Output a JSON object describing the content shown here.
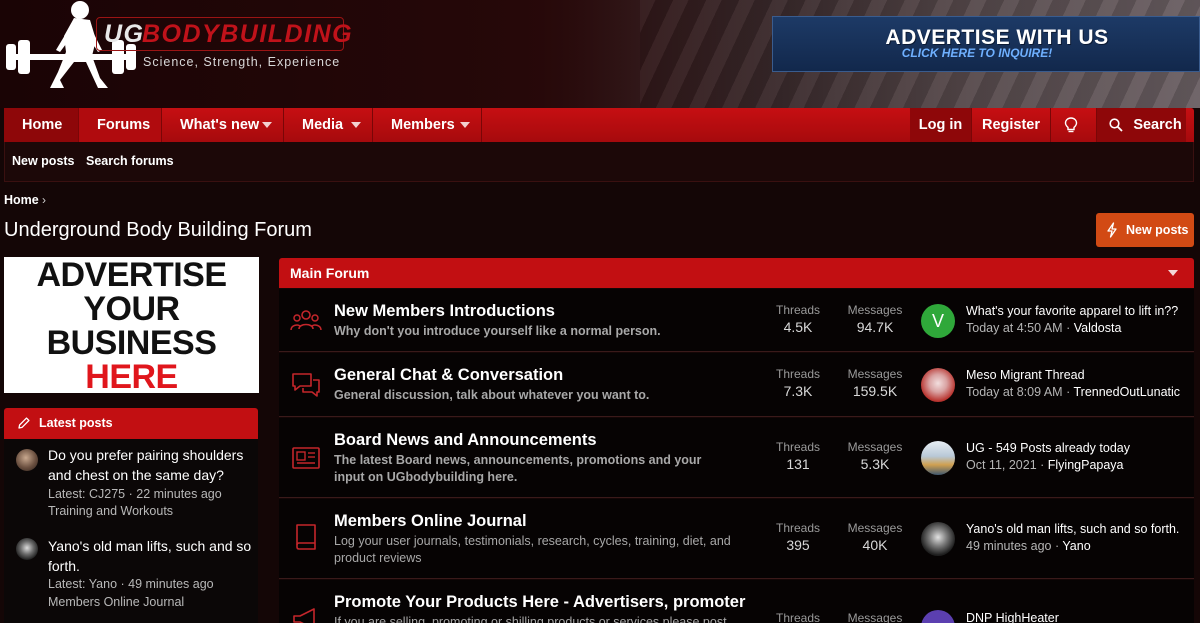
{
  "header": {
    "logo_ug": "UG",
    "logo_bb": "BODYBUILDING",
    "logo_tagline": "Science, Strength, Experience",
    "ad_title": "ADVERTISE WITH US",
    "ad_subtitle": "CLICK HERE TO INQUIRE!"
  },
  "nav": {
    "home": "Home",
    "forums": "Forums",
    "whats_new": "What's new",
    "media": "Media",
    "members": "Members",
    "login": "Log in",
    "register": "Register",
    "search": "Search"
  },
  "subnav": {
    "new_posts": "New posts",
    "search_forums": "Search forums"
  },
  "breadcrumb": {
    "home": "Home",
    "sep": "›"
  },
  "page": {
    "title": "Underground Body Building Forum",
    "new_posts_button": "New posts"
  },
  "sidebar": {
    "ad_lines": [
      "ADVERTISE",
      "YOUR",
      "BUSINESS",
      "HERE"
    ],
    "latest_title": "Latest posts",
    "latest": [
      {
        "title": "Do you prefer pairing shoulders and chest on the same day?",
        "meta": "Latest: CJ275 · 22 minutes ago",
        "forum": "Training and Workouts"
      },
      {
        "title": "Yano's old man lifts, such and so forth.",
        "meta": "Latest: Yano · 49 minutes ago",
        "forum": "Members Online Journal"
      }
    ]
  },
  "main": {
    "section_title": "Main Forum",
    "forums": [
      {
        "title": "New Members Introductions",
        "desc": "Why don't you introduce yourself like a normal person.",
        "threads_label": "Threads",
        "threads": "4.5K",
        "messages_label": "Messages",
        "messages": "94.7K",
        "last_title": "What's your favorite apparel to lift in??",
        "last_time": "Today at 4:50 AM",
        "last_user": "Valdosta",
        "avatar_letter": "V",
        "avatar_color": "#2fa83a"
      },
      {
        "title": "General Chat & Conversation",
        "desc": "General discussion, talk about whatever you want to.",
        "threads_label": "Threads",
        "threads": "7.3K",
        "messages_label": "Messages",
        "messages": "159.5K",
        "last_title": "Meso Migrant Thread",
        "last_time": "Today at 8:09 AM",
        "last_user": "TrennedOutLunatic"
      },
      {
        "title": "Board News and Announcements",
        "desc": "The latest Board news, announcements, promotions and your input on UGbodybuilding here.",
        "threads_label": "Threads",
        "threads": "131",
        "messages_label": "Messages",
        "messages": "5.3K",
        "last_title": "UG - 549 Posts already today",
        "last_time": "Oct 11, 2021",
        "last_user": "FlyingPapaya"
      },
      {
        "title": "Members Online Journal",
        "desc": "Log your user journals, testimonials, research, cycles, training, diet, and product reviews",
        "threads_label": "Threads",
        "threads": "395",
        "messages_label": "Messages",
        "messages": "40K",
        "last_title": "Yano's old man lifts, such and so forth.",
        "last_time": "49 minutes ago",
        "last_user": "Yano"
      },
      {
        "title": "Promote Your Products Here - Advertisers, promoter",
        "desc": "If you are selling, promoting or shilling products or services please post in",
        "threads_label": "Threads",
        "messages_label": "Messages",
        "last_title": "DNP HighHeater"
      }
    ]
  },
  "colors": {
    "nav_red": "#c60f12",
    "accent_orange": "#d24a14",
    "row_bg": "#060303"
  }
}
